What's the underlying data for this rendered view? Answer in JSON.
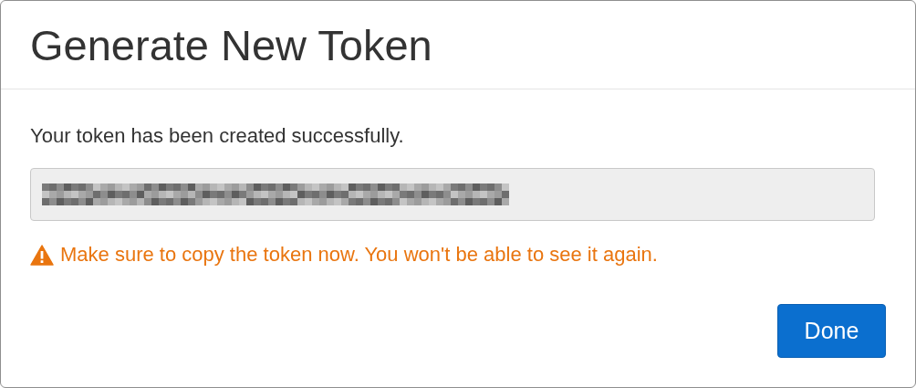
{
  "dialog": {
    "title": "Generate New Token",
    "message": "Your token has been created successfully.",
    "warning": "Make sure to copy the token now. You won't be able to see it again.",
    "buttons": [
      {
        "label": "Done",
        "kind": "primary"
      }
    ]
  }
}
